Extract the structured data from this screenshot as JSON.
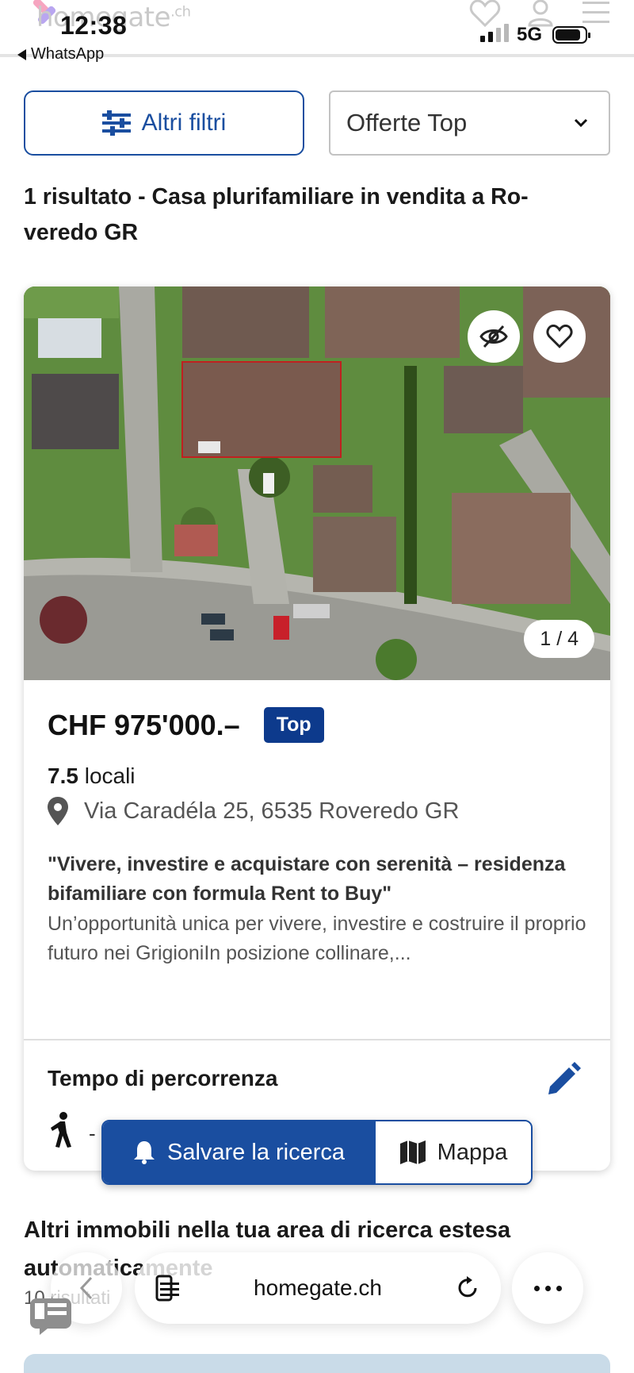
{
  "status_bar": {
    "time": "12:38",
    "back_app": "WhatsApp",
    "network": "5G"
  },
  "header": {
    "logo_text": "homegate",
    "logo_tld": ".ch"
  },
  "filters": {
    "more_filters_label": "Altri filtri",
    "sort_value": "Offerte Top"
  },
  "results": {
    "title": "1 risultato - Casa plurifamiliare in vendita a Ro­veredo GR"
  },
  "listing": {
    "photo_counter": "1 / 4",
    "price": "CHF 975'000.–",
    "badge": "Top",
    "rooms_value": "7.5",
    "rooms_label": "locali",
    "address": "Via Caradéla 25, 6535 Roveredo GR",
    "headline": "\"Vivere, investire e acquistare con serenità – residenza bifamiliare con formula Rent to Buy\"",
    "description": "Un’opportunità unica per vivere, investire e costruire il proprio futuro nei GrigioniIn posizione collinare,...",
    "travel_title": "Tempo di percorrenza",
    "travel_value": "-"
  },
  "actions": {
    "save_search": "Salvare la ricerca",
    "map": "Mappa"
  },
  "more": {
    "title": "Altri immobili nella tua area di ricerca estesa automaticamente",
    "count": "10 risultati"
  },
  "browser": {
    "url": "homegate.ch"
  },
  "colors": {
    "brand_blue": "#1a4ea0",
    "badge_navy": "#0d3a8c",
    "lawn_green": "#5e8a3e"
  }
}
